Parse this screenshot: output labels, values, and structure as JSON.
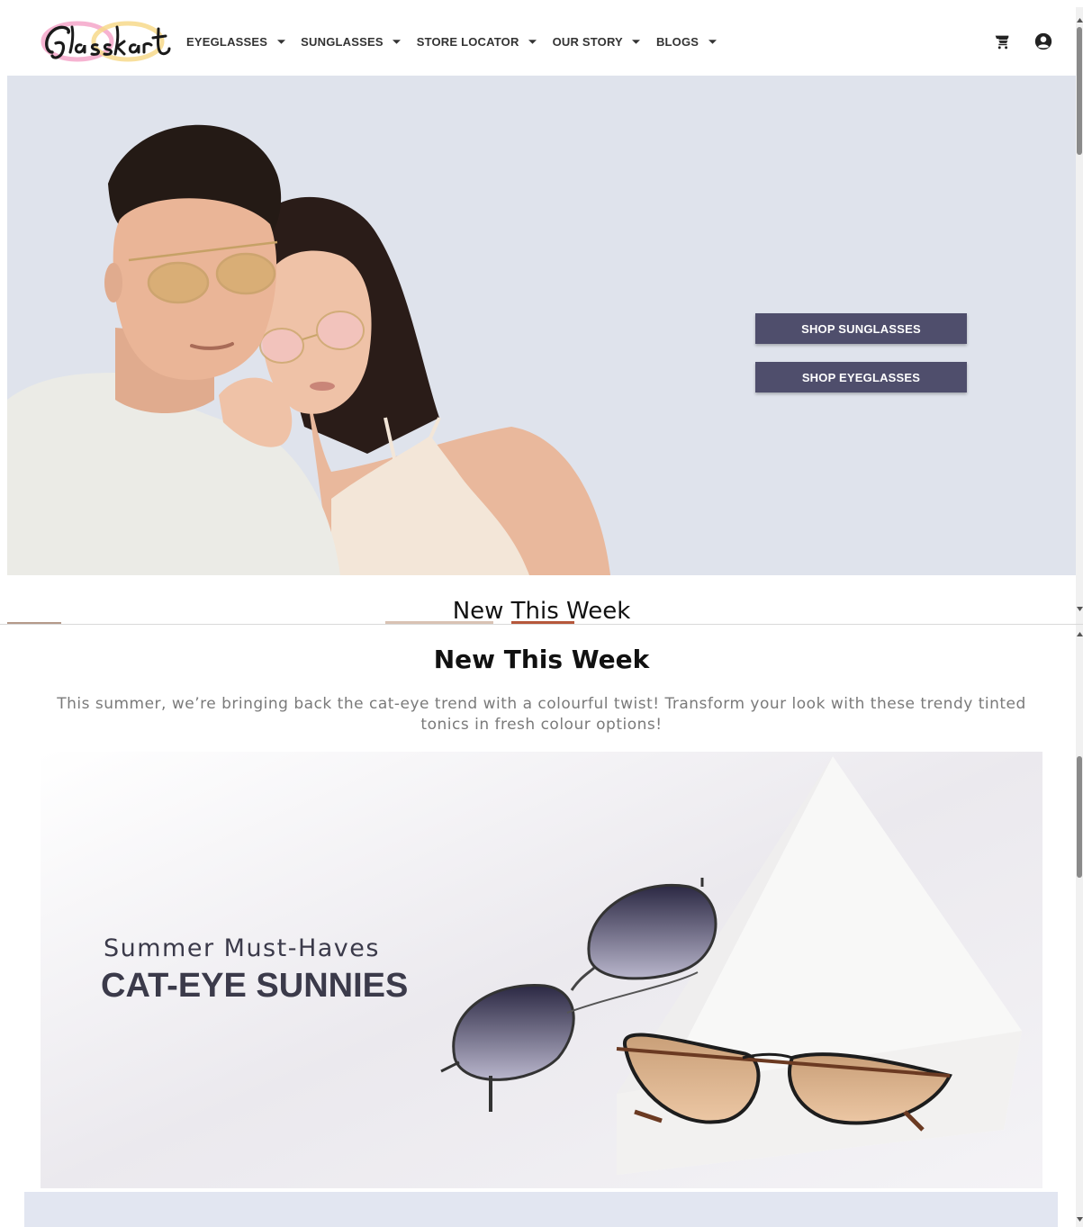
{
  "brand": {
    "logo_text": "Glasskart"
  },
  "nav": {
    "items": [
      {
        "label": "EYEGLASSES"
      },
      {
        "label": "SUNGLASSES"
      },
      {
        "label": "STORE LOCATOR"
      },
      {
        "label": "OUR STORY"
      },
      {
        "label": "BLOGS"
      }
    ],
    "icons": [
      "cart-icon",
      "account-icon"
    ]
  },
  "hero": {
    "buttons": {
      "shop_sunglasses": "SHOP SUNGLASSES",
      "shop_eyeglasses": "SHOP EYEGLASSES"
    },
    "background_color": "#dfe3ec",
    "button_color": "#4f4e6c"
  },
  "new_this_week": {
    "title": "New This Week",
    "description": "This summer, we’re bringing back the cat-eye trend with a colourful twist! Transform your look with these trendy tinted tonics in fresh colour options!",
    "banner": {
      "subtitle": "Summer Must-Haves",
      "headline": "CAT-EYE SUNNIES"
    }
  },
  "colors": {
    "accent": "#4f4e6c",
    "next_section_band": "#e2e6f1"
  }
}
